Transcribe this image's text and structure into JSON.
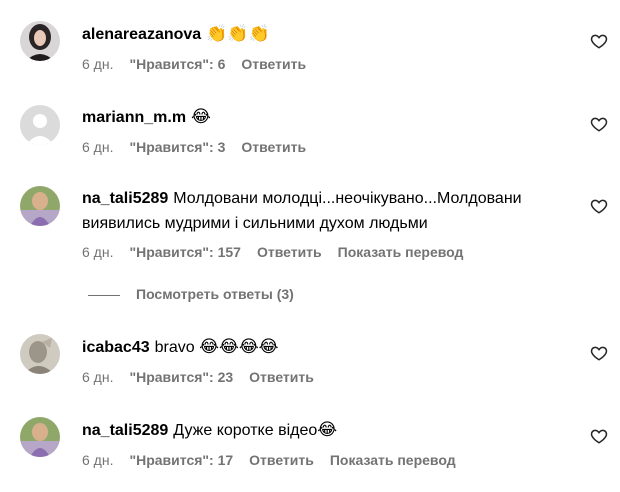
{
  "comments": [
    {
      "username": "alenareazanova",
      "text": "",
      "emoji": "👏👏👏",
      "time": "6 дн.",
      "likes": "\"Нравится\": 6",
      "reply": "Ответить",
      "translate": ""
    },
    {
      "username": "mariann_m.m",
      "text": "",
      "emoji": "😂",
      "time": "6 дн.",
      "likes": "\"Нравится\": 3",
      "reply": "Ответить",
      "translate": ""
    },
    {
      "username": "na_tali5289",
      "text": "Молдовани молодці...неочікувано...Молдовани виявились мудрими і сильними духом людьми",
      "emoji": "",
      "time": "6 дн.",
      "likes": "\"Нравится\": 157",
      "reply": "Ответить",
      "translate": "Показать перевод"
    },
    {
      "username": "icabac43",
      "text": "bravo",
      "emoji": "😂😂😂😂",
      "time": "6 дн.",
      "likes": "\"Нравится\": 23",
      "reply": "Ответить",
      "translate": ""
    },
    {
      "username": "na_tali5289",
      "text": "Дуже коротке відео",
      "emoji": "😂",
      "time": "6 дн.",
      "likes": "\"Нравится\": 17",
      "reply": "Ответить",
      "translate": "Показать перевод"
    }
  ],
  "view_replies": "Посмотреть ответы (3)",
  "colors": {
    "secondary_text": "#737373",
    "primary_text": "#000000"
  }
}
